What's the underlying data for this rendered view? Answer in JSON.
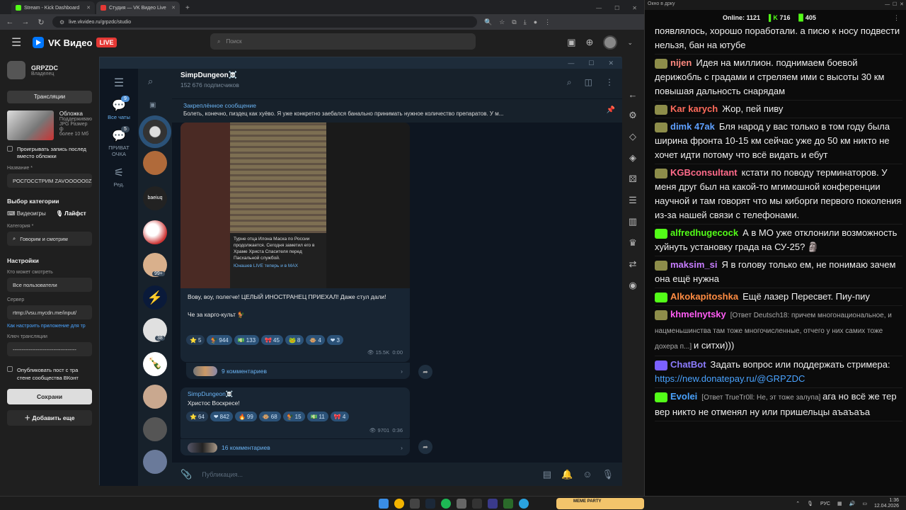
{
  "browser": {
    "tabs": [
      {
        "label": "Stream - Kick Dashboard",
        "color": "#53fc18"
      },
      {
        "label": "Студия — VK Видео Live",
        "color": "#e53935"
      }
    ],
    "url": "live.vkvideo.ru/grpzdc/studio"
  },
  "vk": {
    "brand": "VK Видео",
    "live_badge": "LIVE",
    "search_placeholder": "Поиск",
    "channel_name": "GRPZDC",
    "channel_role": "Владелец",
    "broadcasts_button": "Трансляции",
    "cover_title": "Обложка",
    "cover_hint1": "Поддерживаю",
    "cover_hint2": "JPG Размер ф",
    "cover_hint3": "более 10 Мб",
    "play_record_label": "Проигрывать запись послед вместо обложки",
    "name_label": "Название *",
    "name_value": "РОСГОССТРИМ ZAVOOOOO0Z",
    "category_section": "Выбор категории",
    "cat_games": "Видеоигры",
    "cat_lifestyle": "Лайфст",
    "category_label": "Категория *",
    "category_value": "Говорим и смотрим",
    "settings_section": "Настройки",
    "who_can_watch_label": "Кто может смотреть",
    "who_can_watch_value": "Все пользователи",
    "server_label": "Сервер",
    "server_value": "rtmp://vsu.mycdn.me/input/",
    "setup_link": "Как настроить приложение для тр",
    "key_label": "Ключ трансляции",
    "key_value": "------------------------------------",
    "publish_label": "Опубликовать пост с тра стене сообщества ВКонт",
    "save_button": "Сохрани",
    "add_more_button": "Добавить еще"
  },
  "telegram": {
    "folders": [
      {
        "label": "Все чаты",
        "badge": "9"
      },
      {
        "label": "ПРИВАТ ОЧКА",
        "badge": "5"
      },
      {
        "label": "Ред.",
        "badge": ""
      }
    ],
    "chat_list_badges": [
      "99+",
      "38"
    ],
    "chat_title": "SimpDungeon☠️",
    "subscribers": "152 676 подписчиков",
    "pinned_title": "Закреплённое сообщение",
    "pinned_text": "Болеть, конечно, пиздец как хуёво. Я уже конкретно заебался банально принимать нужное количество препаратов. У м...",
    "post1": {
      "image_caption": "Турне отца Илона Маска по России продолжается. Сегодня заметил его в Храме Христа Спасителя перед Пасхальной службой.",
      "image_footer": "Юнашев LIVE теперь и в MAX",
      "text1": "Вову, воу, полегче! ЦЕЛЫЙ ИНОСТРАНЕЦ ПРИЕХАЛ! Даже стул дали!",
      "text2": "Че за карго-культ 🐓",
      "reactions": [
        {
          "emoji": "⭐",
          "count": "5"
        },
        {
          "emoji": "🐓",
          "count": "944"
        },
        {
          "emoji": "💵",
          "count": "133"
        },
        {
          "emoji": "🎀",
          "count": "45"
        },
        {
          "emoji": "🐸",
          "count": "8"
        },
        {
          "emoji": "🐵",
          "count": "4"
        },
        {
          "emoji": "❤",
          "count": "3"
        }
      ],
      "views": "15.5K",
      "time": "0:00",
      "comments": "9 комментариев"
    },
    "post2": {
      "author": "SimpDungeon☠️",
      "text": "Христос Воскресе!",
      "reactions": [
        {
          "emoji": "⭐",
          "count": "64"
        },
        {
          "emoji": "❤",
          "count": "842"
        },
        {
          "emoji": "🔥",
          "count": "99"
        },
        {
          "emoji": "🐵",
          "count": "68"
        },
        {
          "emoji": "🐓",
          "count": "15"
        },
        {
          "emoji": "💵",
          "count": "11"
        },
        {
          "emoji": "🎀",
          "count": "4"
        }
      ],
      "views": "9701",
      "time": "0:36",
      "comments": "16 комментариев"
    },
    "composer_placeholder": "Публикация..."
  },
  "chat": {
    "window_title": "Окно в дрку",
    "online_label": "Online:",
    "online_count": "1121",
    "stat_kick": "716",
    "stat_other": "405",
    "messages": [
      {
        "user": "",
        "color": "#efefef",
        "reply": "",
        "text": "появлялось, хорошо поработали. а писю к носу подвести нельзя, бан на ютубе",
        "badge": ""
      },
      {
        "user": "nijen",
        "color": "#ff8a80",
        "reply": "",
        "text": "Идея на миллион. поднимаем боевой дерижобль с градами и стреляем ими с высоты 30 км повышая дальность снарядам",
        "badge": "#8d8d4a"
      },
      {
        "user": "Kar karych",
        "color": "#ff6b5b",
        "reply": "",
        "text": "Жор, пей пиву",
        "badge": "#8d8d4a"
      },
      {
        "user": "dimk 47ak",
        "color": "#5ea0ff",
        "reply": "",
        "text": "Бля народ у вас только в том году была ширина фронта 10-15 км сейчас уже до 50 км никто не хочет идти потому что всё видать и ебут",
        "badge": "#8d8d4a"
      },
      {
        "user": "KGBconsultant",
        "color": "#ff6b8a",
        "reply": "",
        "text": "кстати по поводу терминаторов. У меня друг был на какой-то мгимошной конференции научной и там говорят что мы киборги первого поколения из-за нашей связи с телефонами.",
        "badge": "#8d8d4a"
      },
      {
        "user": "alfredhugecock",
        "color": "#53fc18",
        "reply": "",
        "text": "А в МО уже отклонили возможность хуйнуть установку града на СУ-25? 🗿",
        "badge": "#53fc18"
      },
      {
        "user": "maksim_si",
        "color": "#c77dff",
        "reply": "",
        "text": "Я в голову только ем, не понимаю зачем она ещё нужна",
        "badge": "#8d8d4a"
      },
      {
        "user": "Alkokapitoshka",
        "color": "#ff8c42",
        "reply": "",
        "text": "Ещё лазер Пересвет. Пиу-пиу",
        "badge": "#53fc18"
      },
      {
        "user": "khmelnytsky",
        "color": "#ff5cf4",
        "reply": "[Ответ Deutsch18: причем многонациональное, и нацменьшинства там тоже многочисленные, отчего у них самих тоже дохера п...]",
        "text": "и ситхи)))",
        "badge": "#8d8d4a"
      },
      {
        "user": "ChatBot",
        "color": "#8c7cff",
        "reply": "",
        "text": "Задать вопрос или поддержать стримера: ",
        "link": "https://new.donatepay.ru/@GRPZDC",
        "badge": "#7b61ff"
      },
      {
        "user": "Evolei",
        "color": "#4aa3ff",
        "reply": "[Ответ TrueTr0ll: Не, эт тоже залупа]",
        "text": "ага но всё же тер вер никто не отменял ну или пришельцы аъаъаъа",
        "badge": "#53fc18"
      }
    ]
  },
  "taskbar": {
    "lang": "РУС",
    "time": "1:36",
    "date": "12.04.2026",
    "widget_label": "MEME PARTY"
  }
}
